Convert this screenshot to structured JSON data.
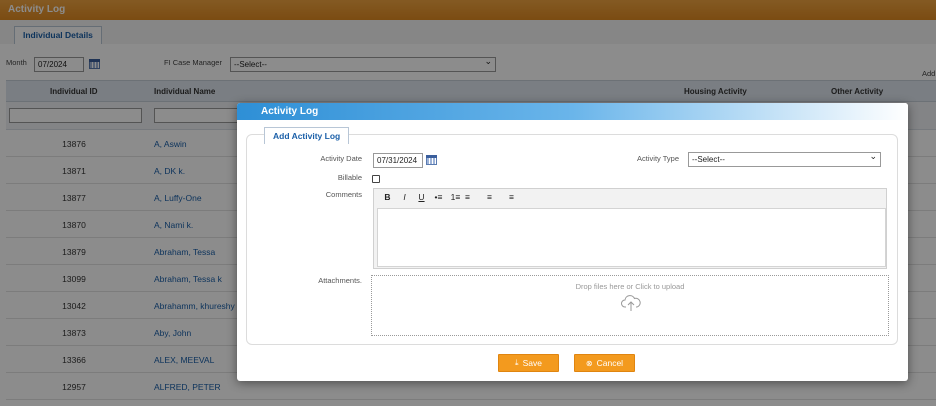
{
  "page": {
    "title": "Activity Log",
    "tab": "Individual Details",
    "filters": {
      "month_label": "Month",
      "month_value": "07/2024",
      "case_manager_label": "FI Case Manager",
      "case_manager_value": "--Select--",
      "add_label": "Add"
    },
    "grid": {
      "columns": [
        "Individual ID",
        "Individual Name",
        "Housing Activity",
        "Other Activity"
      ],
      "rows": [
        {
          "id": "13876",
          "name": "A, Aswin"
        },
        {
          "id": "13871",
          "name": "A, DK k."
        },
        {
          "id": "13877",
          "name": "A, Luffy-One"
        },
        {
          "id": "13870",
          "name": "A, Nami k."
        },
        {
          "id": "13879",
          "name": "Abraham, Tessa"
        },
        {
          "id": "13099",
          "name": "Abraham, Tessa k"
        },
        {
          "id": "13042",
          "name": "Abrahamm, khureshy"
        },
        {
          "id": "13873",
          "name": "Aby, John"
        },
        {
          "id": "13366",
          "name": "ALEX, MEEVAL"
        },
        {
          "id": "12957",
          "name": "ALFRED, PETER"
        }
      ]
    }
  },
  "modal": {
    "title": "Activity Log",
    "tab": "Add Activity Log",
    "activity_date_label": "Activity Date",
    "activity_date_value": "07/31/2024",
    "activity_type_label": "Activity Type",
    "activity_type_value": "--Select--",
    "billable_label": "Billable",
    "comments_label": "Comments",
    "attachments_label": "Attachments.",
    "drop_text": "Drop files here or Click to upload",
    "toolbar": [
      "B",
      "I",
      "U",
      "•≡",
      "1≡",
      "≡",
      "≡",
      "≡"
    ],
    "save_label": "Save",
    "cancel_label": "Cancel"
  }
}
